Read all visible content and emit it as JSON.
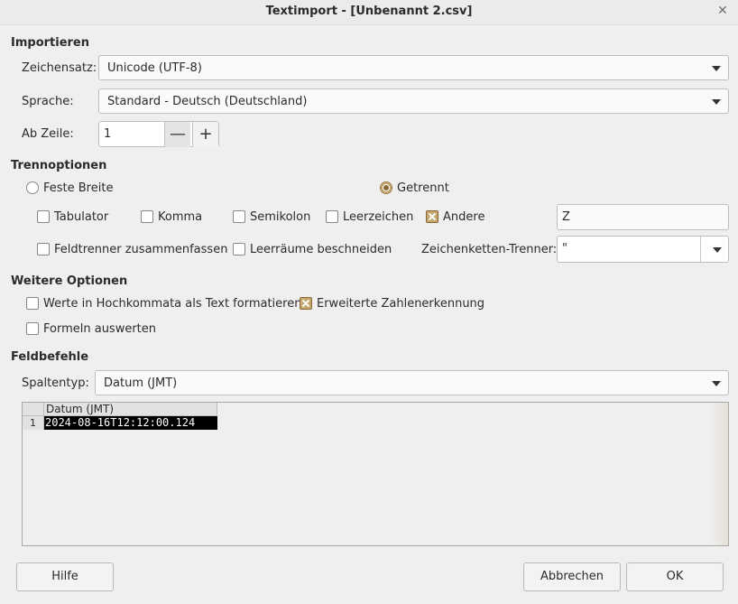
{
  "window": {
    "title": "Textimport - [Unbenannt 2.csv]"
  },
  "import": {
    "section": "Importieren",
    "charset_label": "Zeichensatz:",
    "charset_value": "Unicode (UTF-8)",
    "language_label": "Sprache:",
    "language_value": "Standard - Deutsch (Deutschland)",
    "from_row_label": "Ab Zeile:",
    "from_row_value": "1"
  },
  "separator": {
    "section": "Trennoptionen",
    "fixed_width": {
      "label": "Feste Breite",
      "selected": false
    },
    "separated": {
      "label": "Getrennt",
      "selected": true
    },
    "tab": {
      "label": "Tabulator",
      "checked": false
    },
    "comma": {
      "label": "Komma",
      "checked": false
    },
    "semicolon": {
      "label": "Semikolon",
      "checked": false
    },
    "space": {
      "label": "Leerzeichen",
      "checked": false
    },
    "other": {
      "label": "Andere",
      "checked": true
    },
    "other_value": "Z",
    "merge": {
      "label": "Feldtrenner zusammenfassen",
      "checked": false
    },
    "trim": {
      "label": "Leerräume beschneiden",
      "checked": false
    },
    "string_delimiter_label": "Zeichenketten-Trenner:",
    "string_delimiter_value": "\""
  },
  "other_options": {
    "section": "Weitere Optionen",
    "quoted_as_text": {
      "label": "Werte in Hochkommata als Text formatieren",
      "checked": false
    },
    "detect_special": {
      "label": "Erweiterte Zahlenerkennung",
      "checked": true
    },
    "evaluate_formulas": {
      "label": "Formeln auswerten",
      "checked": false
    }
  },
  "fields": {
    "section": "Feldbefehle",
    "column_type_label": "Spaltentyp:",
    "column_type_value": "Datum (JMT)",
    "preview": {
      "column_header": "Datum (JMT)",
      "row_number": "1",
      "cell": "2024-08-16T12:12:00.124"
    }
  },
  "buttons": {
    "help": "Hilfe",
    "cancel": "Abbrechen",
    "ok": "OK"
  }
}
